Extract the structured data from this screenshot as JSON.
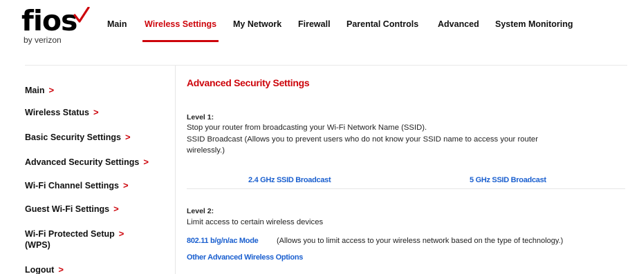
{
  "brand": {
    "name": "fios",
    "tagline": "by verizon",
    "accent": "#cd040b"
  },
  "topnav": {
    "items": [
      {
        "label": "Main"
      },
      {
        "label": "Wireless Settings",
        "active": true
      },
      {
        "label": "My Network"
      },
      {
        "label": "Firewall"
      },
      {
        "label": "Parental Controls"
      },
      {
        "label": "Advanced"
      },
      {
        "label": "System Monitoring"
      }
    ]
  },
  "sidebar": {
    "items": [
      {
        "label": "Main"
      },
      {
        "label": "Wireless Status"
      },
      {
        "label": "Basic Security Settings"
      },
      {
        "label": "Advanced Security Settings"
      },
      {
        "label": "Wi-Fi Channel Settings"
      },
      {
        "label": "Guest Wi-Fi Settings"
      },
      {
        "label": "Wi-Fi Protected Setup",
        "label2": "(WPS)"
      },
      {
        "label": "Logout"
      }
    ],
    "chevron": ">"
  },
  "main": {
    "title": "Advanced Security Settings",
    "level1": {
      "label": "Level 1:",
      "line1": "Stop your router from broadcasting your Wi-Fi Network Name (SSID).",
      "line2": "SSID Broadcast (Allows you to prevent users who do not know your SSID name to access your router",
      "line3": "wirelessly.)",
      "link_24": "2.4 GHz SSID Broadcast",
      "link_5": "5 GHz SSID Broadcast"
    },
    "level2": {
      "label": "Level 2:",
      "line1": "Limit access to certain wireless devices",
      "mode_link": "802.11 b/g/n/ac Mode",
      "mode_note": "(Allows you to limit access to your wireless network based on the type of technology.)",
      "other_link": "Other Advanced Wireless Options"
    }
  },
  "colors": {
    "link": "#1a5fcf",
    "accent": "#cd040b"
  }
}
